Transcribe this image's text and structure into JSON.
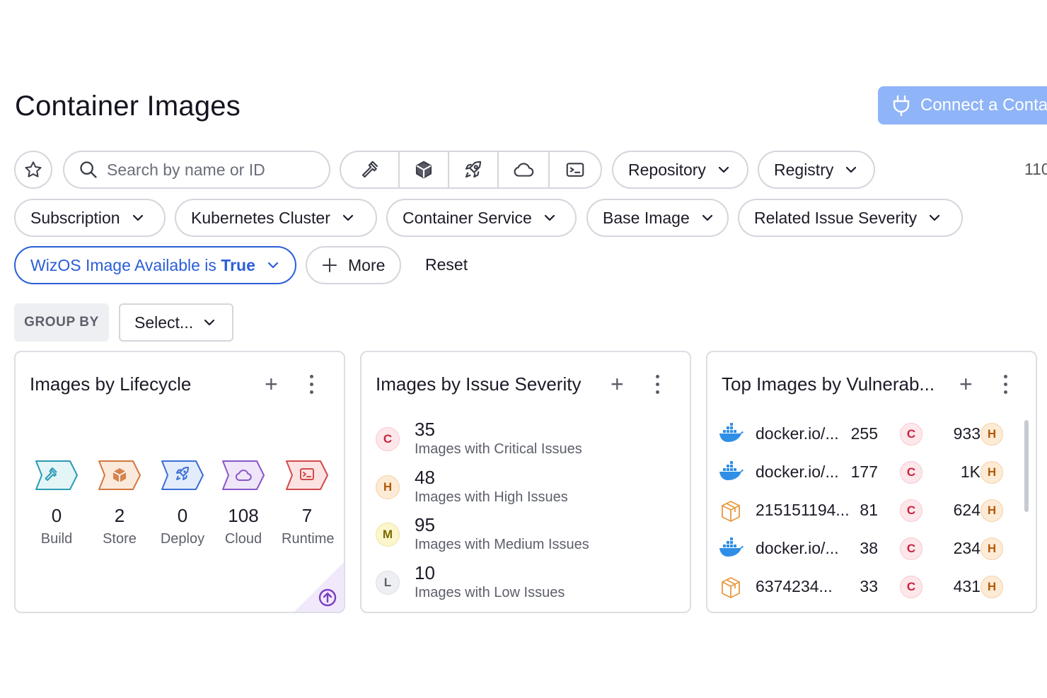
{
  "header": {
    "title": "Container Images",
    "connect_label": "Connect a Conta"
  },
  "toolbar": {
    "search_placeholder": "Search by name or ID",
    "lifecycle_filters": [
      "hammer-icon",
      "box-icon",
      "rocket-icon",
      "cloud-icon",
      "terminal-icon"
    ],
    "repository_label": "Repository",
    "registry_label": "Registry",
    "count": "110"
  },
  "filters": {
    "subscription": "Subscription",
    "kubernetes_cluster": "Kubernetes Cluster",
    "container_service": "Container Service",
    "base_image": "Base Image",
    "related_issue_severity": "Related Issue Severity",
    "active_filter_prefix": "WizOS Image Available is ",
    "active_filter_value": "True",
    "more_label": "More",
    "reset_label": "Reset"
  },
  "group_by": {
    "label": "GROUP BY",
    "select_value": "Select..."
  },
  "cards": {
    "lifecycle": {
      "title": "Images by Lifecycle",
      "stages": [
        {
          "name": "Build",
          "count": "0",
          "icon": "hammer-icon",
          "color": "#2b9bb5",
          "fill": "#e4f5f8"
        },
        {
          "name": "Store",
          "count": "2",
          "icon": "box-icon",
          "color": "#d2793f",
          "fill": "#fbe9dc"
        },
        {
          "name": "Deploy",
          "count": "0",
          "icon": "rocket-icon",
          "color": "#3b6fd6",
          "fill": "#e3ecfb"
        },
        {
          "name": "Cloud",
          "count": "108",
          "icon": "cloud-icon",
          "color": "#8a57c9",
          "fill": "#efe6f9"
        },
        {
          "name": "Runtime",
          "count": "7",
          "icon": "terminal-icon",
          "color": "#d34a4a",
          "fill": "#fbe3e3"
        }
      ]
    },
    "severity": {
      "title": "Images by Issue Severity",
      "rows": [
        {
          "letter": "C",
          "count": "35",
          "desc": "Images with Critical Issues",
          "cls": "c-crit"
        },
        {
          "letter": "H",
          "count": "48",
          "desc": "Images with High Issues",
          "cls": "c-high"
        },
        {
          "letter": "M",
          "count": "95",
          "desc": "Images with Medium Issues",
          "cls": "c-med"
        },
        {
          "letter": "L",
          "count": "10",
          "desc": "Images with Low Issues",
          "cls": "c-low"
        }
      ]
    },
    "top_vuln": {
      "title": "Top Images by Vulnerab...",
      "rows": [
        {
          "name": "docker.io/...",
          "critical": "255",
          "high": "933",
          "icon": "docker-icon"
        },
        {
          "name": "docker.io/...",
          "critical": "177",
          "high": "1K",
          "icon": "docker-icon"
        },
        {
          "name": "215151194...",
          "critical": "81",
          "high": "624",
          "icon": "package-icon"
        },
        {
          "name": "docker.io/...",
          "critical": "38",
          "high": "234",
          "icon": "docker-icon"
        },
        {
          "name": "6374234...",
          "critical": "33",
          "high": "431",
          "icon": "package-icon"
        }
      ],
      "critical_letter": "C",
      "high_letter": "H"
    }
  },
  "colors": {
    "accent": "#2b5ed8",
    "connect_bg": "#8fb4f7"
  }
}
